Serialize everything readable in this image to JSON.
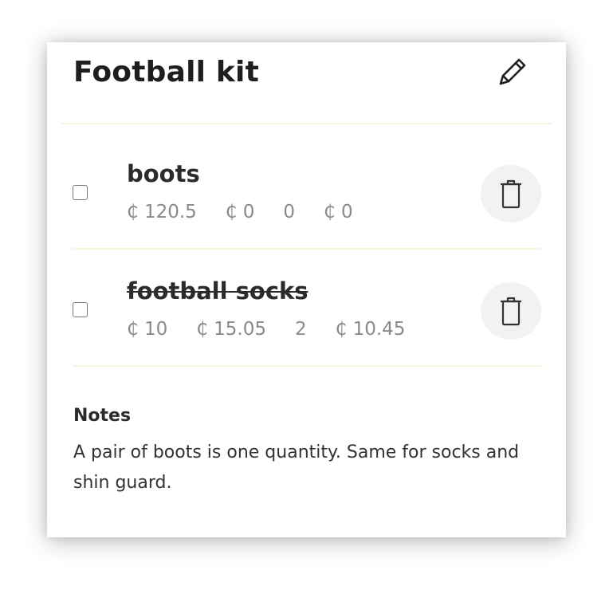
{
  "list": {
    "title": "Football kit",
    "edit_icon": "pencil-icon"
  },
  "items": [
    {
      "name": "boots",
      "checked": false,
      "struck": false,
      "price": "₵ 120.5",
      "paid": "₵ 0",
      "quantity": "0",
      "total": "₵ 0",
      "delete_icon": "trash-icon"
    },
    {
      "name": "football socks",
      "checked": false,
      "struck": true,
      "price": "₵ 10",
      "paid": "₵ 15.05",
      "quantity": "2",
      "total": "₵ 10.45",
      "delete_icon": "trash-icon"
    }
  ],
  "notes": {
    "label": "Notes",
    "text": "A pair of boots is one quantity. Same for socks and shin guard."
  },
  "colors": {
    "divider": "#fbf4dc",
    "delete_button_bg": "#f2f2f2",
    "secondary_text": "#8a8a8a"
  }
}
